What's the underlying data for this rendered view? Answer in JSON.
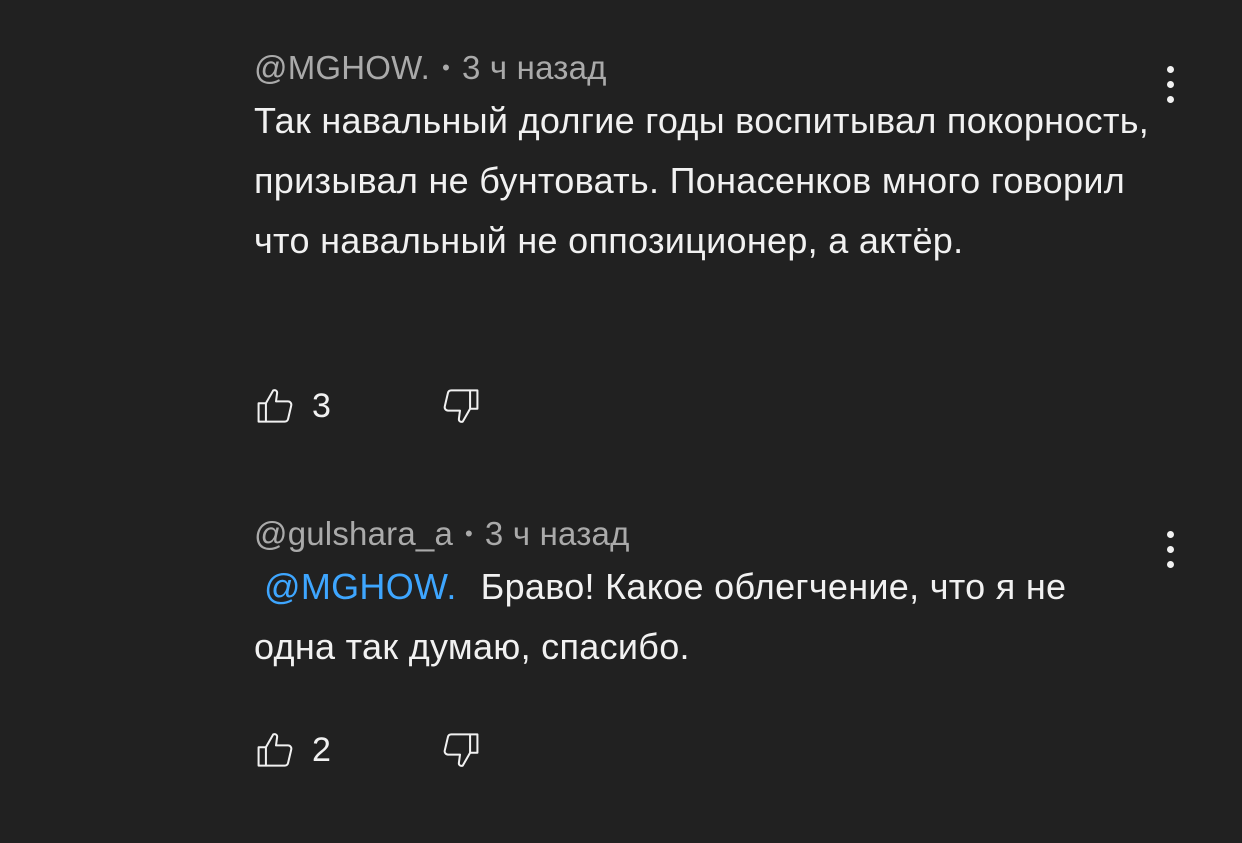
{
  "comments": [
    {
      "author": "@MGHOW.",
      "time": "3 ч назад",
      "mention": "",
      "text": "Так навальный долгие годы воспитывал покорность, призывал не бунтовать. Понасенков много говорил что навальный не оппозиционер, а актёр.",
      "likes": "3"
    },
    {
      "author": "@gulshara_a",
      "time": "3 ч назад",
      "mention": "@MGHOW.",
      "text": "Браво! Какое облегчение, что я не одна так думаю, спасибо.",
      "likes": "2"
    }
  ],
  "separator": "•",
  "icons": {
    "like": "thumbs-up-icon",
    "dislike": "thumbs-down-icon",
    "menu": "more-vertical-icon"
  },
  "colors": {
    "background": "#212121",
    "text": "#f1f1f1",
    "meta": "#aaaaaa",
    "mention": "#3ea6ff"
  }
}
